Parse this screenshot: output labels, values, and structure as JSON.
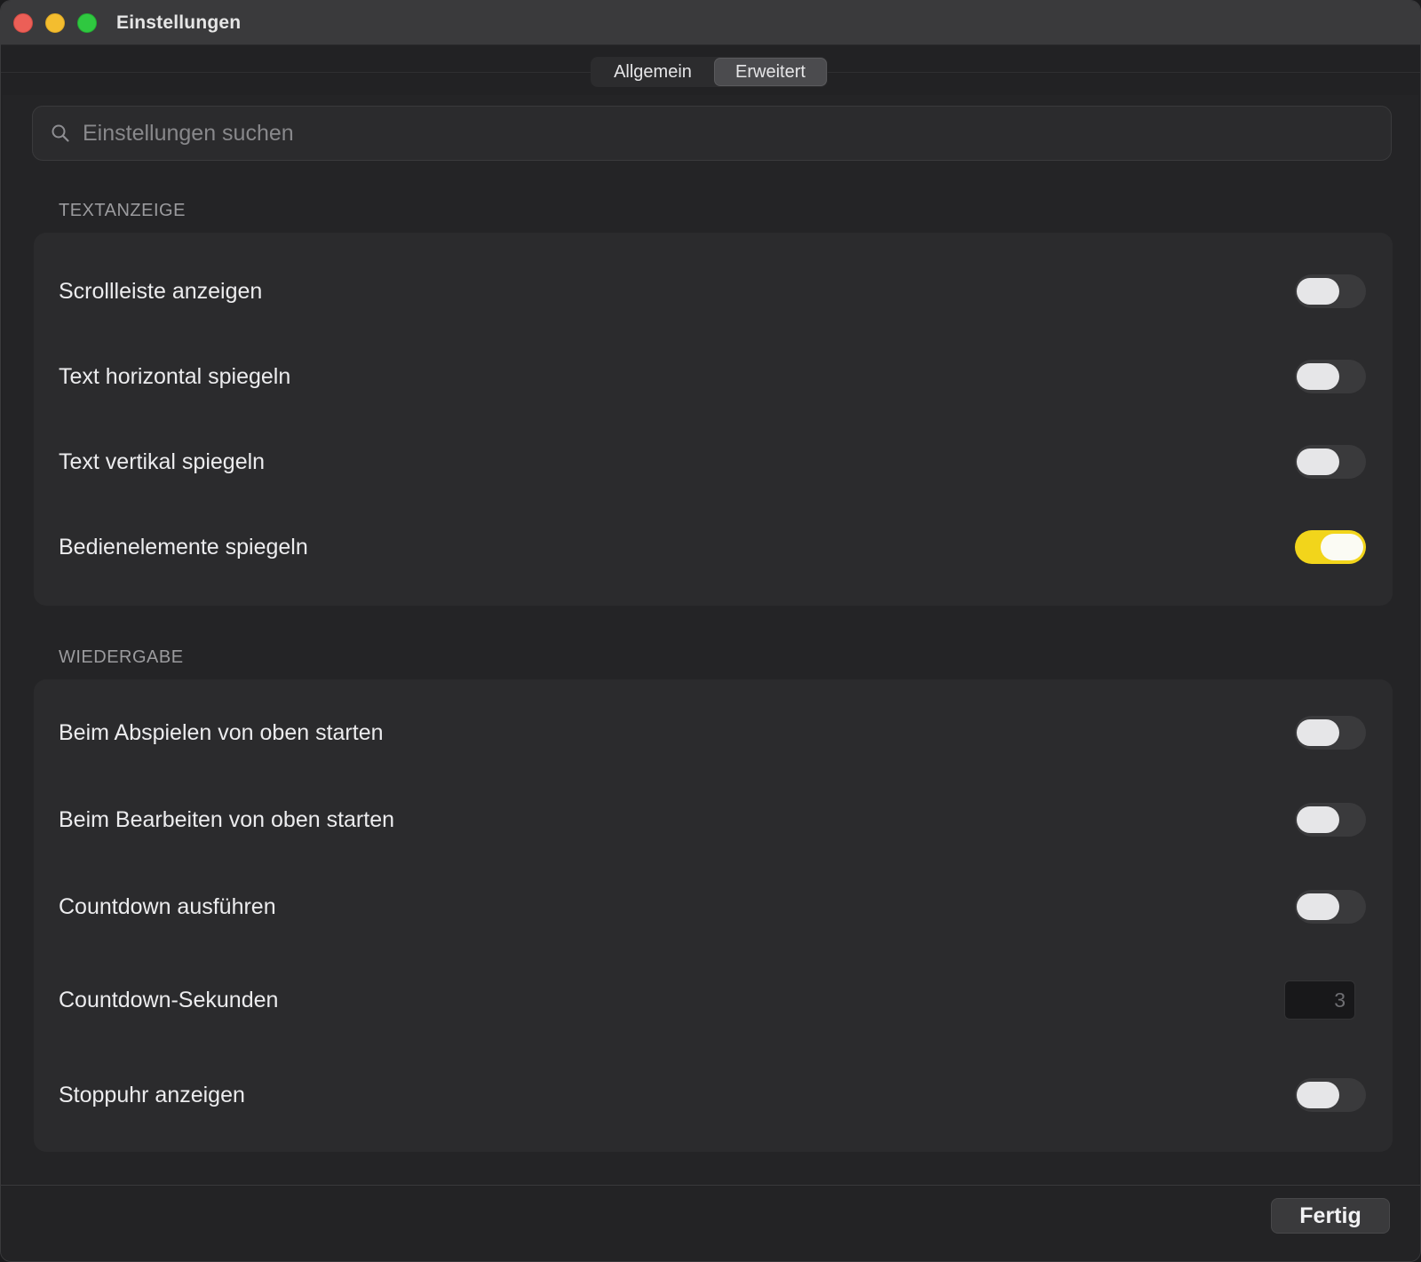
{
  "window": {
    "title": "Einstellungen"
  },
  "tabs": [
    {
      "label": "Allgemein",
      "selected": false
    },
    {
      "label": "Erweitert",
      "selected": true
    }
  ],
  "search": {
    "placeholder": "Einstellungen suchen",
    "value": "",
    "icon": "search-icon"
  },
  "sections": [
    {
      "header": "TEXTANZEIGE",
      "rows": [
        {
          "label": "Scrollleiste anzeigen",
          "control": "toggle",
          "on": false
        },
        {
          "label": "Text horizontal spiegeln",
          "control": "toggle",
          "on": false
        },
        {
          "label": "Text vertikal spiegeln",
          "control": "toggle",
          "on": false
        },
        {
          "label": "Bedienelemente spiegeln",
          "control": "toggle",
          "on": true
        }
      ]
    },
    {
      "header": "WIEDERGABE",
      "rows": [
        {
          "label": "Beim Abspielen von oben starten",
          "control": "toggle",
          "on": false
        },
        {
          "label": "Beim Bearbeiten von oben starten",
          "control": "toggle",
          "on": false
        },
        {
          "label": "Countdown ausführen",
          "control": "toggle",
          "on": false
        },
        {
          "label": "Countdown-Sekunden",
          "control": "number",
          "value": "3"
        },
        {
          "label": "Stoppuhr anzeigen",
          "control": "toggle",
          "on": false
        }
      ]
    }
  ],
  "footer": {
    "done_label": "Fertig"
  },
  "colors": {
    "accent": "#f2d51b",
    "window_bg": "#222224",
    "card_bg": "#2b2b2d"
  }
}
